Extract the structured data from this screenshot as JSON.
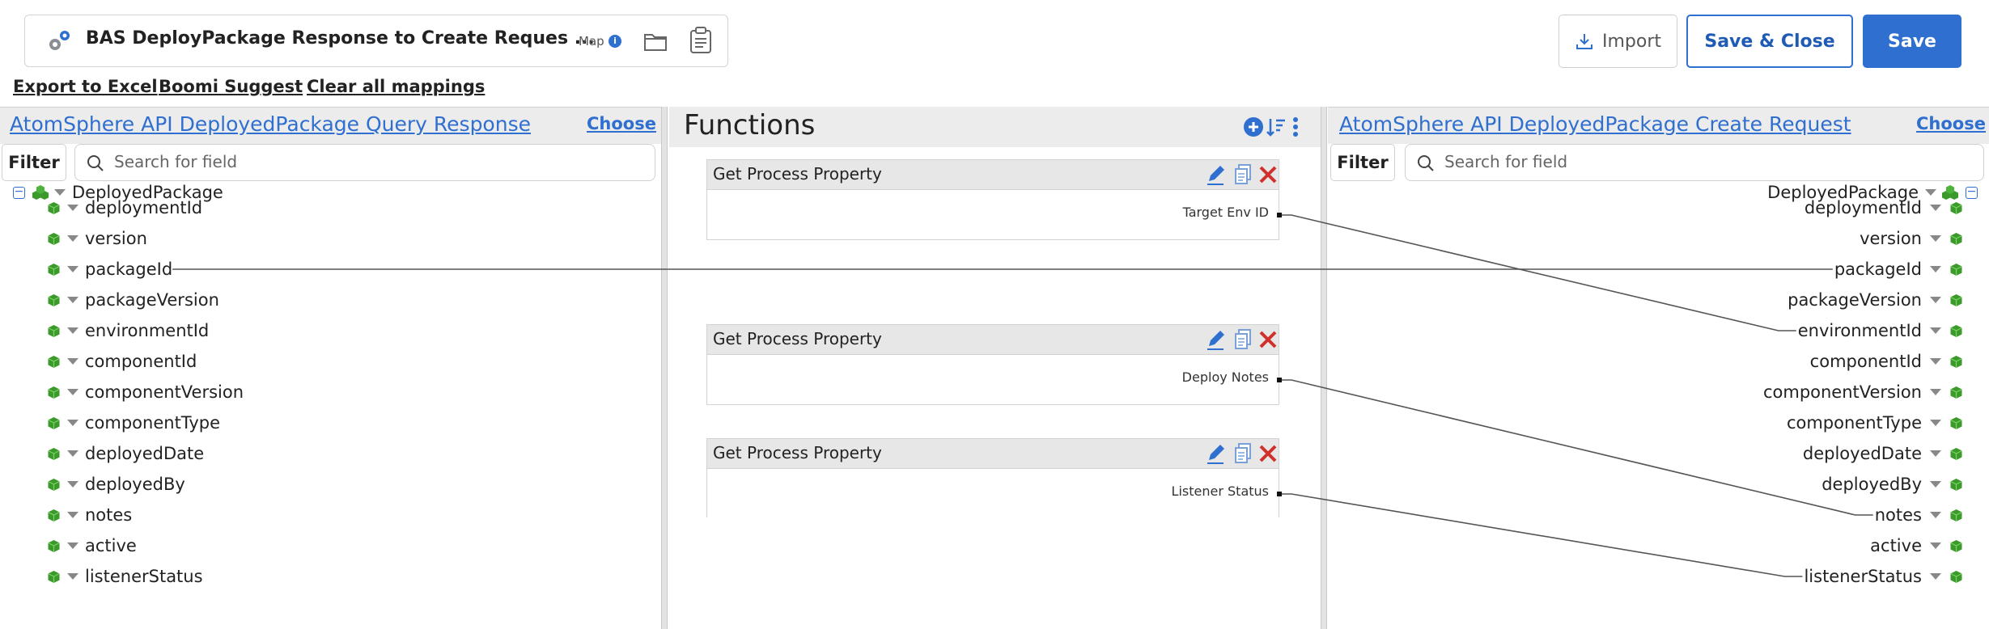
{
  "header": {
    "title": "BAS DeployPackage Response to Create Reques ...",
    "map_tag": "Map",
    "import_label": "Import",
    "save_close_label": "Save & Close",
    "save_label": "Save"
  },
  "toolbar": {
    "export_label": "Export to Excel",
    "suggest_label": "Boomi Suggest",
    "clear_label": "Clear all mappings"
  },
  "source": {
    "profile_name": "AtomSphere API DeployedPackage Query Response",
    "choose_label": "Choose",
    "filter_label": "Filter",
    "search_placeholder": "Search for field",
    "root": "DeployedPackage",
    "fields": [
      "deploymentId",
      "version",
      "packageId",
      "packageVersion",
      "environmentId",
      "componentId",
      "componentVersion",
      "componentType",
      "deployedDate",
      "deployedBy",
      "notes",
      "active",
      "listenerStatus"
    ]
  },
  "functions": {
    "title": "Functions",
    "cards": [
      {
        "title": "Get Process Property",
        "output": "Target Env ID"
      },
      {
        "title": "Get Process Property",
        "output": "Deploy Notes"
      },
      {
        "title": "Get Process Property",
        "output": "Listener Status"
      }
    ]
  },
  "target": {
    "profile_name": "AtomSphere API DeployedPackage Create Request",
    "choose_label": "Choose",
    "filter_label": "Filter",
    "search_placeholder": "Search for field",
    "root": "DeployedPackage",
    "fields": [
      "deploymentId",
      "version",
      "packageId",
      "packageVersion",
      "environmentId",
      "componentId",
      "componentVersion",
      "componentType",
      "deployedDate",
      "deployedBy",
      "notes",
      "active",
      "listenerStatus"
    ]
  },
  "mappings": [
    {
      "from": "source.packageId",
      "to": "target.packageId"
    },
    {
      "from": "function.Target Env ID",
      "to": "target.environmentId"
    },
    {
      "from": "function.Deploy Notes",
      "to": "target.notes"
    },
    {
      "from": "function.Listener Status",
      "to": "target.listenerStatus"
    }
  ],
  "colors": {
    "accent": "#2f6fd0",
    "delete": "#d0312d",
    "element_icon": "#3a9a2a"
  },
  "icons": {
    "map": "gears-icon",
    "info": "info-icon",
    "folder": "folder-icon",
    "notes": "notes-icon",
    "import": "download-icon",
    "search": "search-icon",
    "add_function": "plus-circle-icon",
    "sort": "sort-icon",
    "more": "vertical-dots-icon",
    "edit": "pencil-icon",
    "copy": "copy-icon",
    "delete": "x-icon",
    "field": "cube-icon",
    "root": "cubes-icon",
    "collapse": "minus-box-icon",
    "expand_arrow": "caret-down-icon"
  }
}
